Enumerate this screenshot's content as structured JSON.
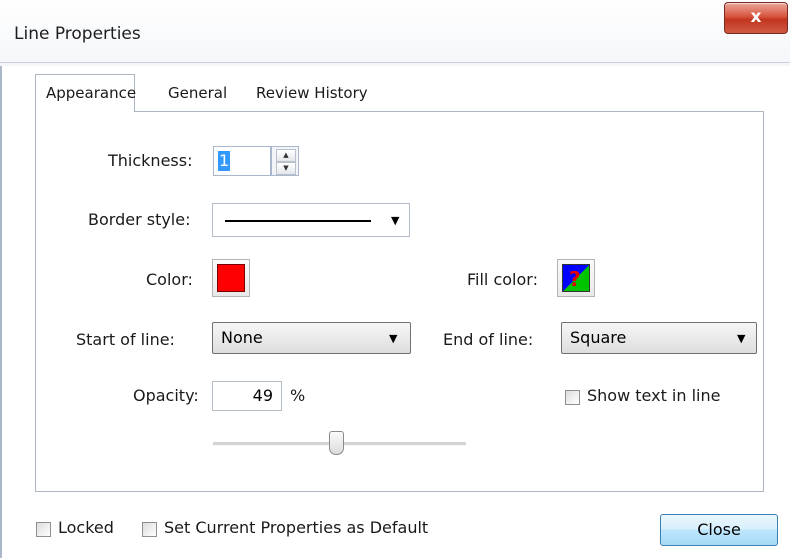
{
  "window": {
    "title": "Line Properties",
    "close_glyph": "x"
  },
  "tabs": [
    {
      "label": "Appearance",
      "active": true
    },
    {
      "label": "General",
      "active": false
    },
    {
      "label": "Review History",
      "active": false
    }
  ],
  "appearance": {
    "thickness": {
      "label": "Thickness:",
      "value": "1"
    },
    "border_style": {
      "label": "Border style:",
      "selected": "solid-line"
    },
    "color": {
      "label": "Color:",
      "value": "#ff0000"
    },
    "fill_color": {
      "label": "Fill color:",
      "value": "no-fill"
    },
    "start_of_line": {
      "label": "Start of line:",
      "value": "None"
    },
    "end_of_line": {
      "label": "End of line:",
      "value": "Square"
    },
    "opacity": {
      "label": "Opacity:",
      "value": "49",
      "unit": "%",
      "slider_fraction": 0.49
    },
    "show_text_in_line": {
      "label": "Show text in line",
      "checked": false
    }
  },
  "footer": {
    "locked": {
      "label": "Locked",
      "checked": false
    },
    "set_default": {
      "label": "Set Current Properties as Default",
      "checked": false
    },
    "close_label": "Close"
  },
  "icons": {
    "spin_up": "spin-up-icon",
    "spin_down": "spin-down-icon",
    "dropdown": "chevron-down-icon"
  }
}
